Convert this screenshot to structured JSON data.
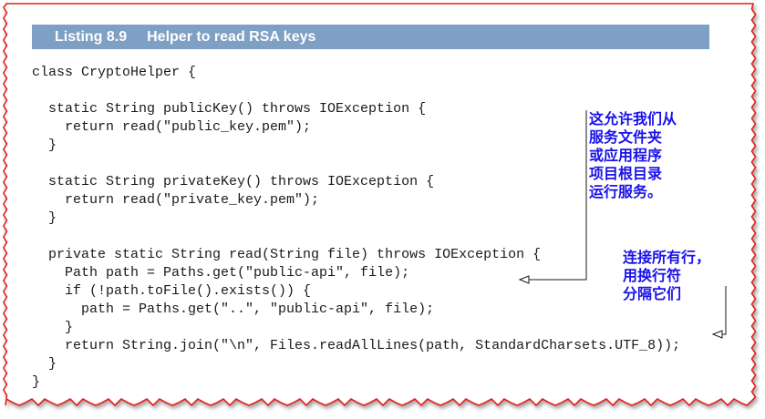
{
  "listing": {
    "number": "Listing 8.9",
    "title": "Helper to read RSA keys"
  },
  "code": {
    "lines": [
      "class CryptoHelper {",
      "",
      "  static String publicKey() throws IOException {",
      "    return read(\"public_key.pem\");",
      "  }",
      "",
      "  static String privateKey() throws IOException {",
      "    return read(\"private_key.pem\");",
      "  }",
      "",
      "  private static String read(String file) throws IOException {",
      "    Path path = Paths.get(\"public-api\", file);",
      "    if (!path.toFile().exists()) {",
      "      path = Paths.get(\"..\", \"public-api\", file);",
      "    }",
      "    return String.join(\"\\n\", Files.readAllLines(path, StandardCharsets.UTF_8));",
      "  }",
      "}"
    ]
  },
  "annotations": [
    {
      "lines": [
        "这允许我们从",
        "服务文件夹",
        "或应用程序",
        "项目根目录",
        "运行服务。"
      ]
    },
    {
      "lines": [
        "连接所有行，",
        "用换行符",
        "分隔它们"
      ]
    }
  ],
  "colors": {
    "frame": "#e0201a",
    "header_bg": "#7da0c4",
    "annotation": "#1a12e8"
  }
}
